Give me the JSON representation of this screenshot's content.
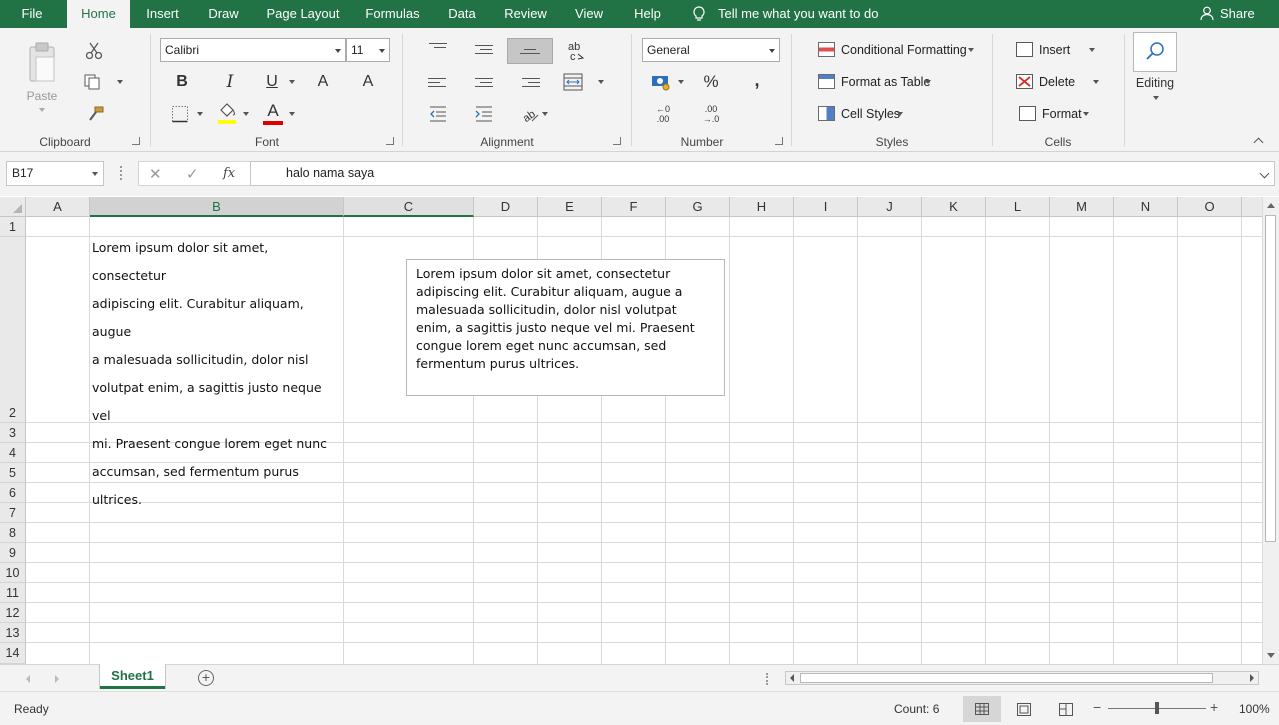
{
  "menu": {
    "file": "File",
    "tabs": [
      "Home",
      "Insert",
      "Draw",
      "Page Layout",
      "Formulas",
      "Data",
      "Review",
      "View",
      "Help"
    ],
    "active_tab": "Home",
    "tell_me": "Tell me what you want to do",
    "share": "Share"
  },
  "ribbon": {
    "clipboard": {
      "label": "Clipboard",
      "paste": "Paste"
    },
    "font": {
      "label": "Font",
      "font_name": "Calibri",
      "font_size": "11",
      "bold": "B",
      "italic": "I",
      "underline": "U",
      "grow": "A",
      "shrink": "A",
      "font_color_letter": "A"
    },
    "alignment": {
      "label": "Alignment"
    },
    "number": {
      "label": "Number",
      "format": "General",
      "percent": "%",
      "comma": ",",
      "increase_decimal_top": "←0",
      "increase_decimal_bottom": ".00",
      "decrease_decimal_top": ".00",
      "decrease_decimal_bottom": "→.0"
    },
    "styles": {
      "label": "Styles",
      "conditional_formatting": "Conditional Formatting",
      "format_as_table": "Format as Table",
      "cell_styles": "Cell Styles"
    },
    "cells": {
      "label": "Cells",
      "insert": "Insert",
      "delete": "Delete",
      "format": "Format"
    },
    "editing": {
      "label": "Editing"
    }
  },
  "formula_bar": {
    "name_box": "B17",
    "cancel": "✕",
    "enter": "✓",
    "fx": "fx",
    "content": "halo nama saya"
  },
  "grid": {
    "columns": [
      "A",
      "B",
      "C",
      "D",
      "E",
      "F",
      "G",
      "H",
      "I",
      "J",
      "K",
      "L",
      "M",
      "N",
      "O"
    ],
    "rows": [
      "1",
      "2",
      "3",
      "4",
      "5",
      "6",
      "7",
      "8",
      "9",
      "10",
      "11",
      "12",
      "13",
      "14"
    ],
    "cell_B2_lines": [
      "Lorem ipsum dolor sit amet, consectetur",
      "adipiscing elit. Curabitur aliquam, augue",
      "a malesuada sollicitudin, dolor nisl",
      "volutpat enim, a sagittis justo neque vel",
      "mi. Praesent congue lorem eget nunc",
      "accumsan, sed fermentum purus",
      "ultrices."
    ],
    "textbox": "Lorem ipsum dolor sit amet, consectetur adipiscing elit. Curabitur aliquam, augue a malesuada sollicitudin, dolor nisl volutpat enim, a sagittis justo neque vel mi. Praesent congue lorem eget nunc accumsan, sed fermentum purus ultrices."
  },
  "sheets": {
    "tabs": [
      "Sheet1"
    ],
    "add": "+"
  },
  "status": {
    "ready": "Ready",
    "count": "Count: 6",
    "zoom": "100%"
  },
  "colors": {
    "accent": "#217346",
    "font_color_bar": "#e00000",
    "highlight_bar": "#ffff00"
  }
}
